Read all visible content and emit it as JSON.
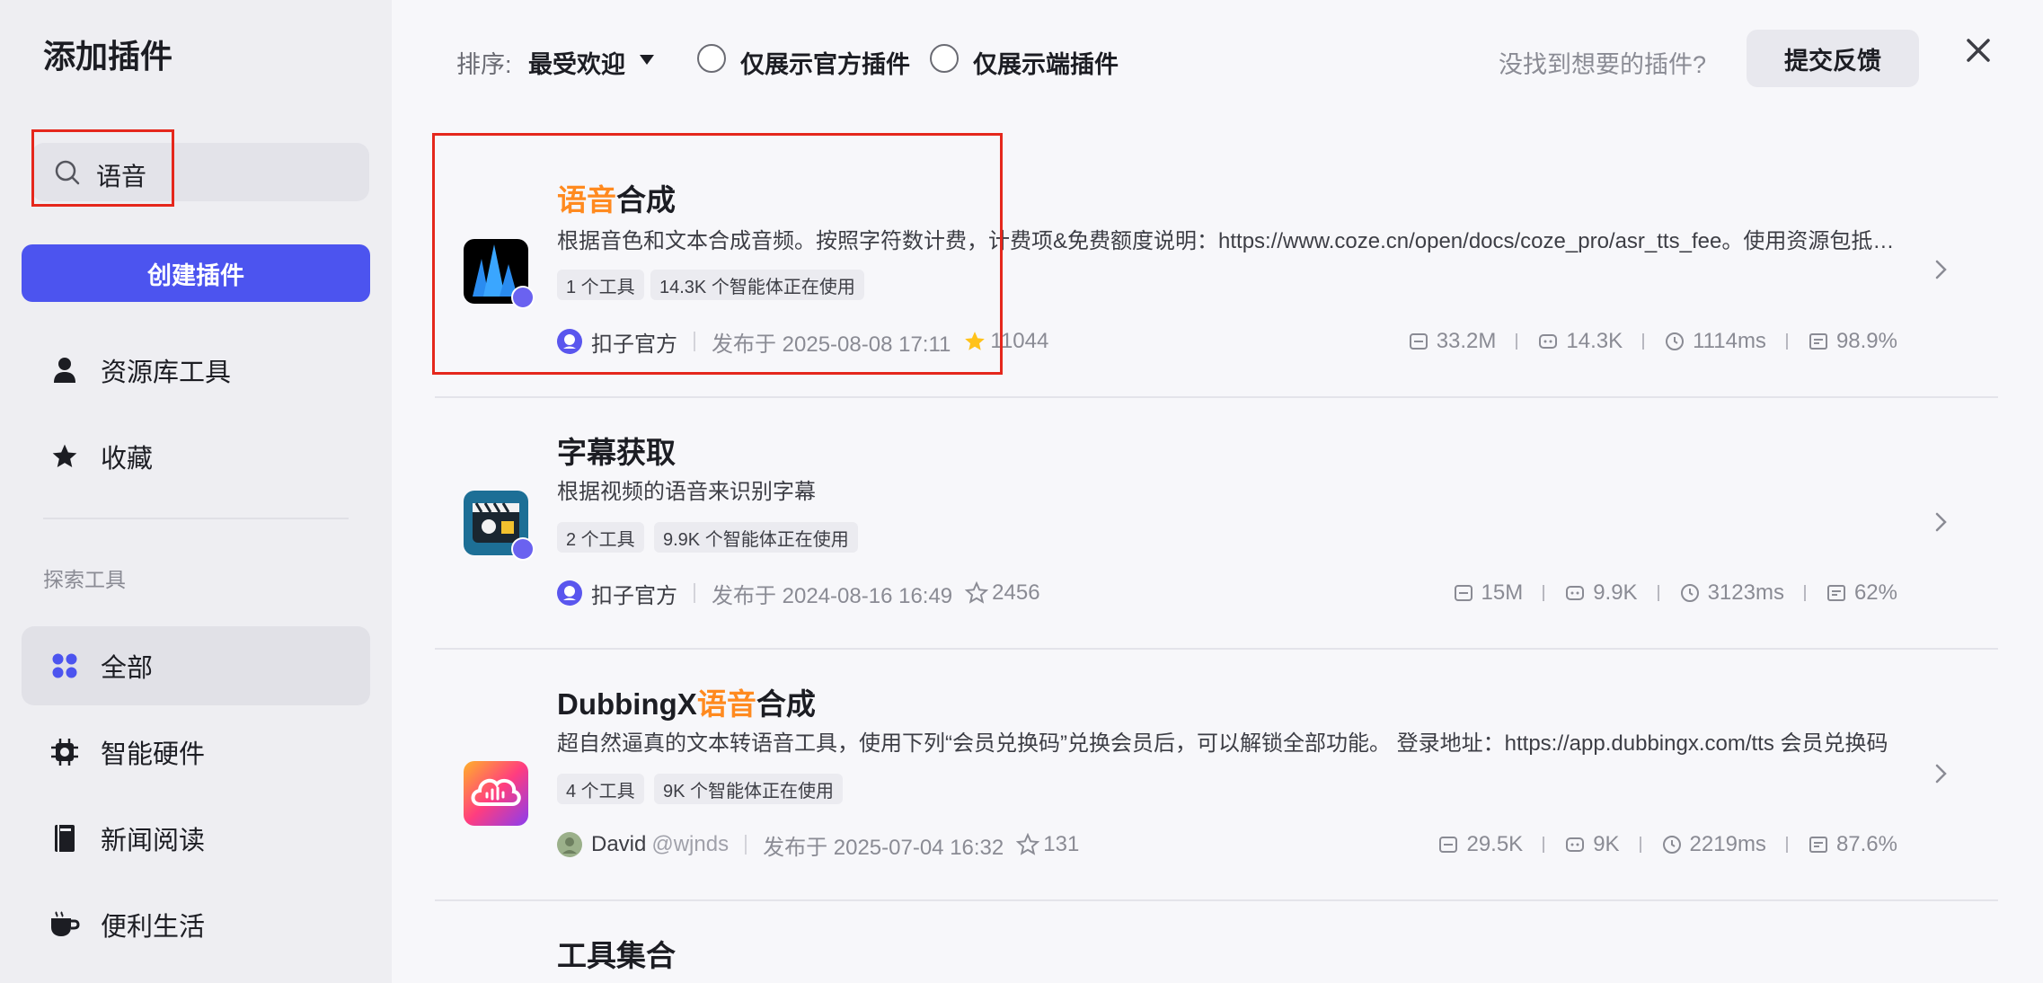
{
  "sidebar": {
    "title": "添加插件",
    "search_value": "语音",
    "create_button": "创建插件",
    "items_top": [
      {
        "label": "资源库工具",
        "icon": "person-icon"
      },
      {
        "label": "收藏",
        "icon": "star-icon"
      }
    ],
    "section_label": "探索工具",
    "items_explore": [
      {
        "label": "全部",
        "icon": "grid-icon",
        "active": true
      },
      {
        "label": "智能硬件",
        "icon": "chip-icon"
      },
      {
        "label": "新闻阅读",
        "icon": "book-icon"
      },
      {
        "label": "便利生活",
        "icon": "coffee-cup-icon"
      }
    ]
  },
  "topbar": {
    "sort_label": "排序:",
    "sort_value": "最受欢迎",
    "filter_official": "仅展示官方插件",
    "filter_client": "仅展示端插件",
    "not_found": "没找到想要的插件?",
    "feedback_button": "提交反馈"
  },
  "plugins": [
    {
      "title_highlight": "语音",
      "title_rest": "合成",
      "title_prefix": "",
      "desc": "根据音色和文本合成音频。按照字符数计费，计费项&免费额度说明：https://www.coze.cn/open/docs/coze_pro/asr_tts_fee。使用资源包抵扣费用。",
      "tag_tools": "1 个工具",
      "tag_usage": "14.3K 个智能体正在使用",
      "author": "扣子官方",
      "handle": "",
      "published": "发布于  2025-08-08 17:11",
      "stars": "11044",
      "favorited": true,
      "stat_calls": "33.2M",
      "stat_bots": "14.3K",
      "stat_latency": "1114ms",
      "stat_success": "98.9%"
    },
    {
      "title_highlight": "",
      "title_rest": "字幕获取",
      "title_prefix": "",
      "desc": "根据视频的语音来识别字幕",
      "tag_tools": "2 个工具",
      "tag_usage": "9.9K 个智能体正在使用",
      "author": "扣子官方",
      "handle": "",
      "published": "发布于  2024-08-16 16:49",
      "stars": "2456",
      "favorited": false,
      "stat_calls": "15M",
      "stat_bots": "9.9K",
      "stat_latency": "3123ms",
      "stat_success": "62%"
    },
    {
      "title_prefix": "DubbingX",
      "title_highlight": "语音",
      "title_rest": "合成",
      "desc": "超自然逼真的文本转语音工具，使用下列“会员兑换码”兑换会员后，可以解锁全部功能。 登录地址：https://app.dubbingx.com/tts 会员兑换码",
      "tag_tools": "4 个工具",
      "tag_usage": "9K 个智能体正在使用",
      "author": "David",
      "handle": "@wjnds",
      "published": "发布于  2025-07-04 16:32",
      "stars": "131",
      "favorited": false,
      "stat_calls": "29.5K",
      "stat_bots": "9K",
      "stat_latency": "2219ms",
      "stat_success": "87.6%"
    },
    {
      "title_prefix": "",
      "title_highlight": "",
      "title_rest": "工具集合"
    }
  ],
  "colors": {
    "accent": "#4c54ef",
    "highlight": "#ff8a1f",
    "annotation": "#e5271c"
  }
}
